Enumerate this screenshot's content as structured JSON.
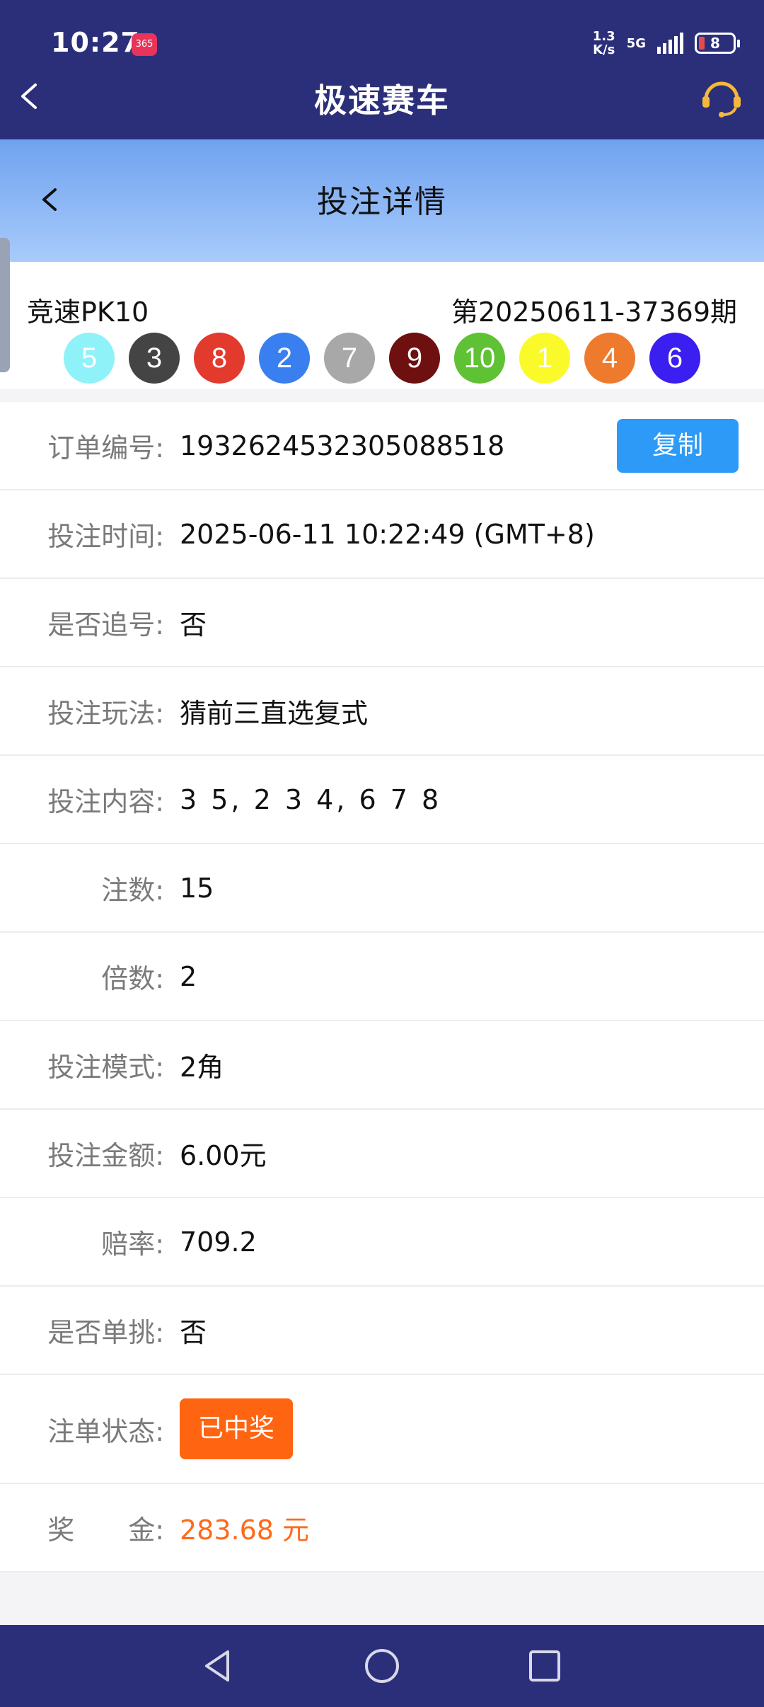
{
  "status_bar": {
    "time": "10:27",
    "app_badge": "365",
    "speed_value": "1.3",
    "speed_unit": "K/s",
    "network": "5G",
    "battery": "8"
  },
  "header": {
    "title": "极速赛车"
  },
  "subheader": {
    "title": "投注详情"
  },
  "draw": {
    "game": "竞速PK10",
    "issue": "第20250611-37369期",
    "balls": [
      {
        "num": "5",
        "color": "#8ff2f8"
      },
      {
        "num": "3",
        "color": "#444444"
      },
      {
        "num": "8",
        "color": "#e23a2c"
      },
      {
        "num": "2",
        "color": "#3a7ff0"
      },
      {
        "num": "7",
        "color": "#a8a8a8"
      },
      {
        "num": "9",
        "color": "#6e1010"
      },
      {
        "num": "10",
        "color": "#5fc234"
      },
      {
        "num": "1",
        "color": "#fafa2a"
      },
      {
        "num": "4",
        "color": "#ee7a2e"
      },
      {
        "num": "6",
        "color": "#3b1ef0"
      }
    ]
  },
  "details": {
    "order_label": "订单编号:",
    "order_value": "1932624532305088518",
    "copy_label": "复制",
    "time_label": "投注时间:",
    "time_value": "2025-06-11 10:22:49 (GMT+8)",
    "chase_label": "是否追号:",
    "chase_value": "否",
    "play_label": "投注玩法:",
    "play_value": "猜前三直选复式",
    "content_label": "投注内容:",
    "content_value": "3 5, 2 3 4, 6 7 8",
    "count_label": "注数:",
    "count_value": "15",
    "multiple_label": "倍数:",
    "multiple_value": "2",
    "mode_label": "投注模式:",
    "mode_value": "2角",
    "amount_label": "投注金额:",
    "amount_value": "6.00元",
    "odds_label": "赔率:",
    "odds_value": "709.2",
    "single_label": "是否单挑:",
    "single_value": "否",
    "state_label": "注单状态:",
    "state_value": "已中奖",
    "prize_label": "奖　　金:",
    "prize_value": "283.68 元"
  },
  "colors": {
    "header_bg": "#2b2f7a",
    "accent_blue": "#2d9af7",
    "win_orange": "#ff6410",
    "prize_orange": "#ff6a1a"
  }
}
